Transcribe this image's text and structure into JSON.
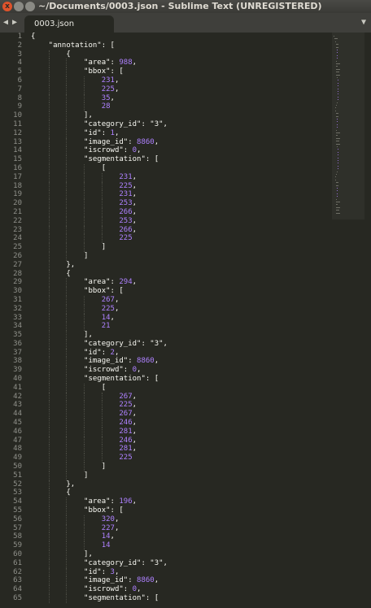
{
  "window": {
    "title": "~/Documents/0003.json - Sublime Text (UNREGISTERED)",
    "close_glyph": "x"
  },
  "tabbar": {
    "nav_left": "◀",
    "nav_right": "▶",
    "active_tab": "0003.json",
    "menu_glyph": "▼"
  },
  "editor": {
    "lines": [
      "{",
      "    \"annotation\": [",
      "        {",
      "            \"area\": 988,",
      "            \"bbox\": [",
      "                231,",
      "                225,",
      "                35,",
      "                28",
      "            ],",
      "            \"category_id\": \"3\",",
      "            \"id\": 1,",
      "            \"image_id\": 8860,",
      "            \"iscrowd\": 0,",
      "            \"segmentation\": [",
      "                [",
      "                    231,",
      "                    225,",
      "                    231,",
      "                    253,",
      "                    266,",
      "                    253,",
      "                    266,",
      "                    225",
      "                ]",
      "            ]",
      "        },",
      "        {",
      "            \"area\": 294,",
      "            \"bbox\": [",
      "                267,",
      "                225,",
      "                14,",
      "                21",
      "            ],",
      "            \"category_id\": \"3\",",
      "            \"id\": 2,",
      "            \"image_id\": 8860,",
      "            \"iscrowd\": 0,",
      "            \"segmentation\": [",
      "                [",
      "                    267,",
      "                    225,",
      "                    267,",
      "                    246,",
      "                    281,",
      "                    246,",
      "                    281,",
      "                    225",
      "                ]",
      "            ]",
      "        },",
      "        {",
      "            \"area\": 196,",
      "            \"bbox\": [",
      "                320,",
      "                227,",
      "                14,",
      "                14",
      "            ],",
      "            \"category_id\": \"3\",",
      "            \"id\": 3,",
      "            \"image_id\": 8860,",
      "            \"iscrowd\": 0,",
      "            \"segmentation\": ["
    ]
  },
  "colors": {
    "background": "#272822",
    "text": "#f8f8f2",
    "number": "#ae81ff",
    "gutter": "#8f908a"
  }
}
